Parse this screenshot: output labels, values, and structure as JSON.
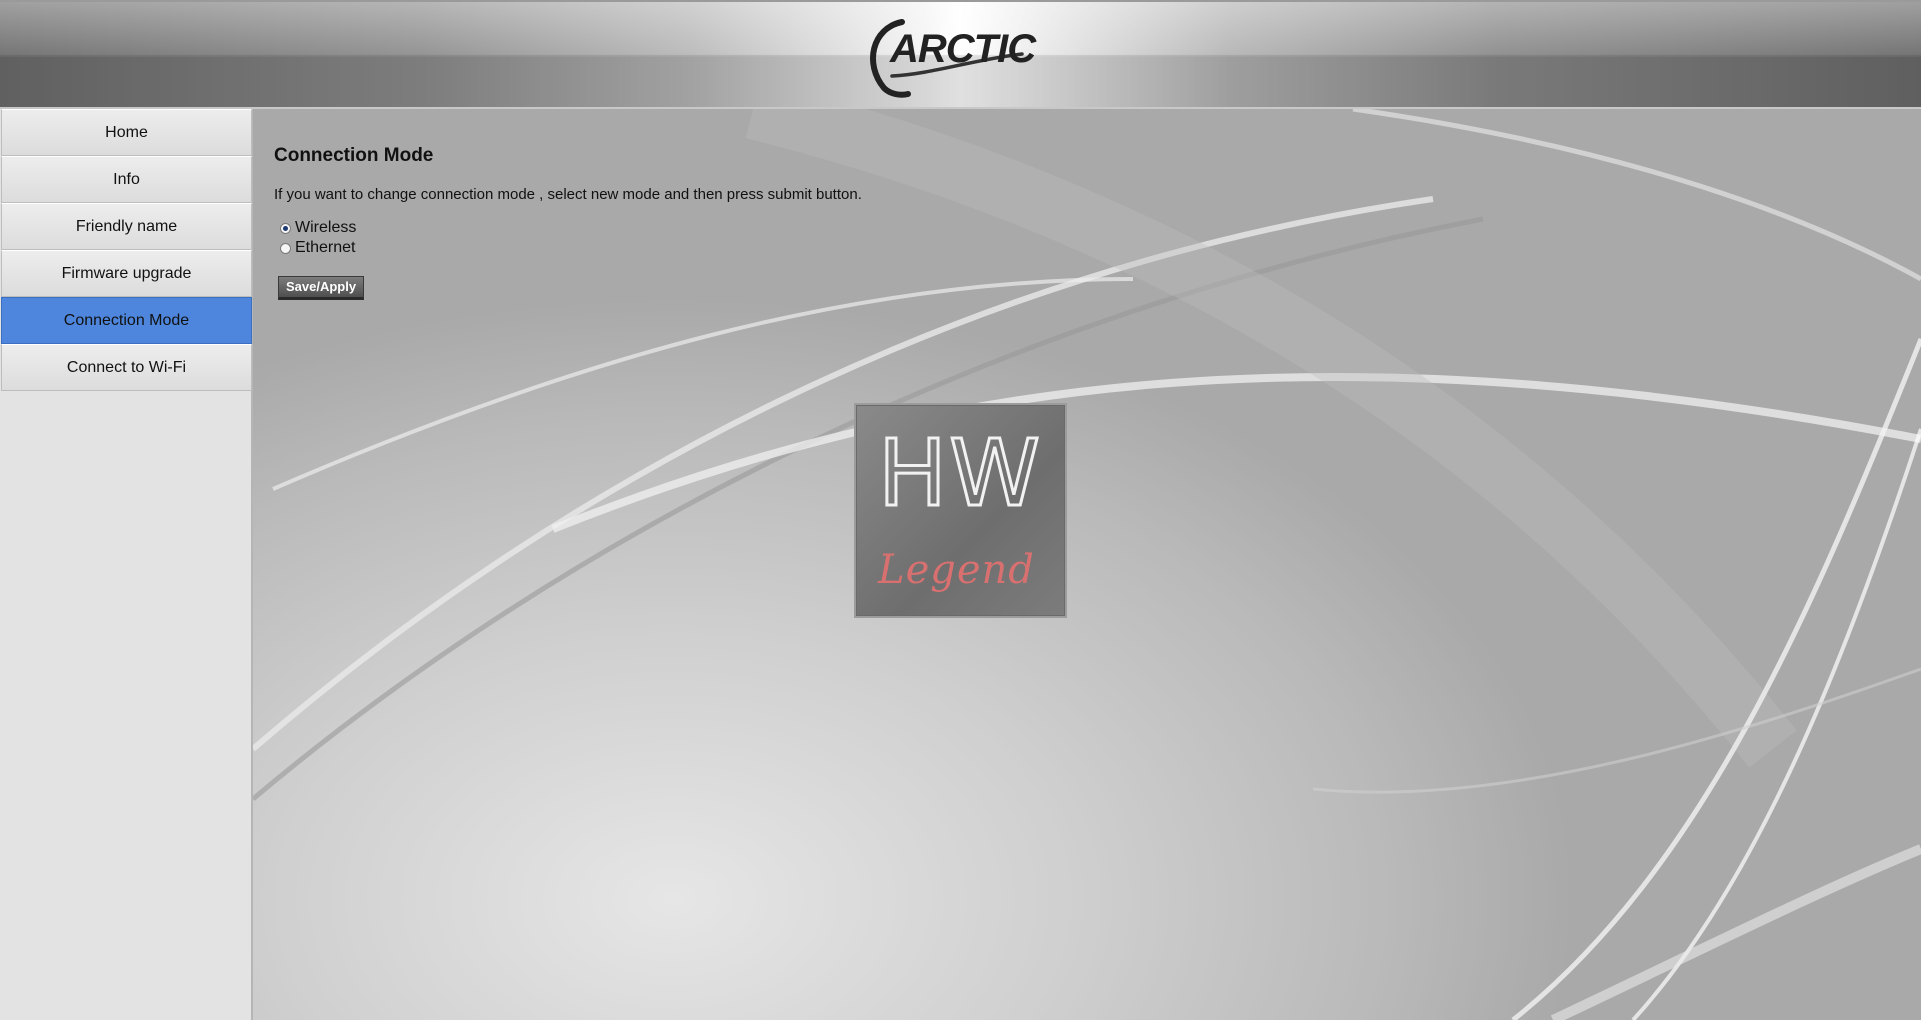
{
  "header": {
    "logo_text": "ARCTIC"
  },
  "sidebar": {
    "items": [
      {
        "label": "Home"
      },
      {
        "label": "Info"
      },
      {
        "label": "Friendly name"
      },
      {
        "label": "Firmware upgrade"
      },
      {
        "label": "Connection Mode",
        "active": true
      },
      {
        "label": "Connect to Wi-Fi"
      }
    ]
  },
  "main": {
    "title": "Connection Mode",
    "instructions": "If you want to change connection mode , select new mode and then press submit button.",
    "options": [
      {
        "label": "Wireless",
        "selected": true
      },
      {
        "label": "Ethernet",
        "selected": false
      }
    ],
    "save_label": "Save/Apply"
  },
  "watermark": {
    "line1": "HW",
    "line2": "Legend"
  },
  "colors": {
    "active_nav": "#4d86dc"
  }
}
